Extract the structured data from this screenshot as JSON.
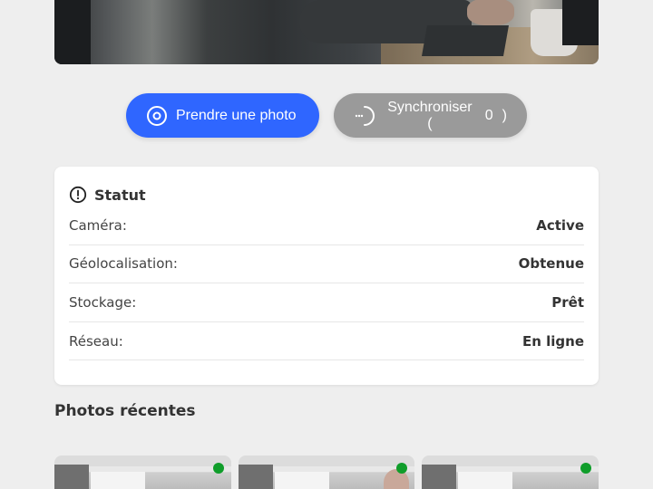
{
  "camera": {
    "preview_icon": "camera-feed"
  },
  "actions": {
    "take_photo_label": "Prendre une photo",
    "take_photo_icon": "capture-icon",
    "sync_label": "Synchroniser (",
    "sync_count": "0",
    "sync_close": ")",
    "sync_icon": "loading-spinner-icon"
  },
  "status": {
    "title": "Statut",
    "icon": "alert-circle-icon",
    "rows": [
      {
        "label": "Caméra:",
        "value": "Active"
      },
      {
        "label": "Géolocalisation:",
        "value": "Obtenue"
      },
      {
        "label": "Stockage:",
        "value": "Prêt"
      },
      {
        "label": "Réseau:",
        "value": "En ligne"
      }
    ]
  },
  "recent": {
    "title": "Photos récentes",
    "photos": [
      {
        "synced_color": "#0f9d2a"
      },
      {
        "synced_color": "#0f9d2a"
      },
      {
        "synced_color": "#0f9d2a"
      }
    ]
  },
  "colors": {
    "primary": "#2f66ff",
    "disabled": "#9a9a9a",
    "synced": "#0f9d2a",
    "background": "#eeeeee"
  }
}
